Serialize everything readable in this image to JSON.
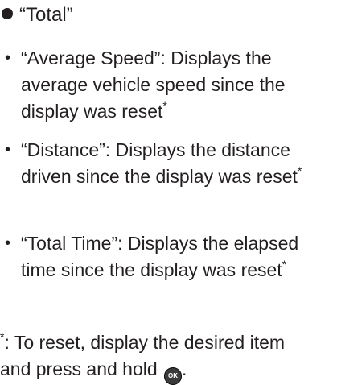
{
  "heading": "“Total”",
  "items": [
    {
      "text": "“Average Speed”: Displays the average vehicle speed since the display was reset",
      "marker": "*"
    },
    {
      "text": "“Distance”: Displays the distance driven since the display was reset",
      "marker": "*"
    },
    {
      "text": "“Total Time”: Displays the elapsed time since the display was reset",
      "marker": "*"
    }
  ],
  "footnote": {
    "marker": "*",
    "line1": ": To reset, display the desired item",
    "line2": "and press and hold",
    "button_label": "OK",
    "end": "."
  },
  "icons": {
    "heading_bullet": "filled-circle-icon",
    "ok_button": "ok-button-icon"
  }
}
